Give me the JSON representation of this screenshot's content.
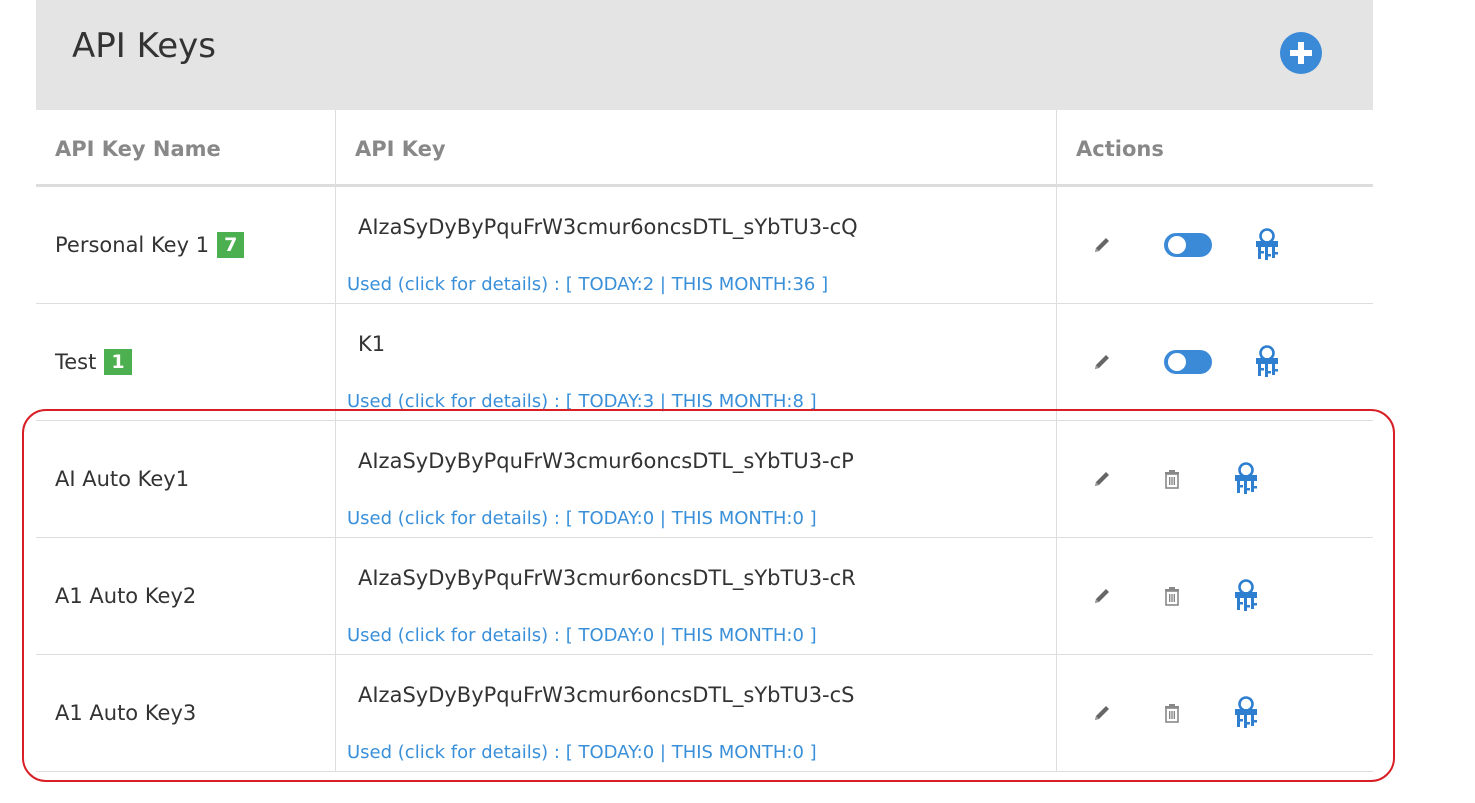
{
  "panel": {
    "title": "API Keys",
    "add_icon": "plus-circle-icon"
  },
  "table": {
    "headers": {
      "name": "API Key Name",
      "key": "API Key",
      "actions": "Actions"
    },
    "rows": [
      {
        "name": "Personal Key 1",
        "badge": "7",
        "api_key": "AIzaSyDyByPquFrW3cmur6oncsDTL_sYbTU3-cQ",
        "usage": "Used (click for details) : [ TODAY:2 | THIS MONTH:36 ]",
        "actions": [
          "edit-icon",
          "toggle-icon",
          "keys-icon"
        ]
      },
      {
        "name": "Test",
        "badge": "1",
        "api_key": "K1",
        "usage": "Used (click for details) : [ TODAY:3 | THIS MONTH:8 ]",
        "actions": [
          "edit-icon",
          "toggle-icon",
          "keys-icon"
        ]
      },
      {
        "name": "AI Auto Key1",
        "badge": "",
        "api_key": "AIzaSyDyByPquFrW3cmur6oncsDTL_sYbTU3-cP",
        "usage": "Used (click for details) : [ TODAY:0 | THIS MONTH:0 ]",
        "actions": [
          "edit-icon",
          "trash-icon",
          "keys-icon"
        ]
      },
      {
        "name": "A1 Auto Key2",
        "badge": "",
        "api_key": "AIzaSyDyByPquFrW3cmur6oncsDTL_sYbTU3-cR",
        "usage": "Used (click for details) : [ TODAY:0 | THIS MONTH:0 ]",
        "actions": [
          "edit-icon",
          "trash-icon",
          "keys-icon"
        ]
      },
      {
        "name": "A1 Auto Key3",
        "badge": "",
        "api_key": "AIzaSyDyByPquFrW3cmur6oncsDTL_sYbTU3-cS",
        "usage": "Used (click for details) : [ TODAY:0 | THIS MONTH:0 ]",
        "actions": [
          "edit-icon",
          "trash-icon",
          "keys-icon"
        ]
      }
    ]
  },
  "colors": {
    "header_bg": "#e4e4e4",
    "accent": "#3b8ad8",
    "link": "#3a8fd9",
    "badge": "#4caf50",
    "highlight": "#d81f26"
  }
}
